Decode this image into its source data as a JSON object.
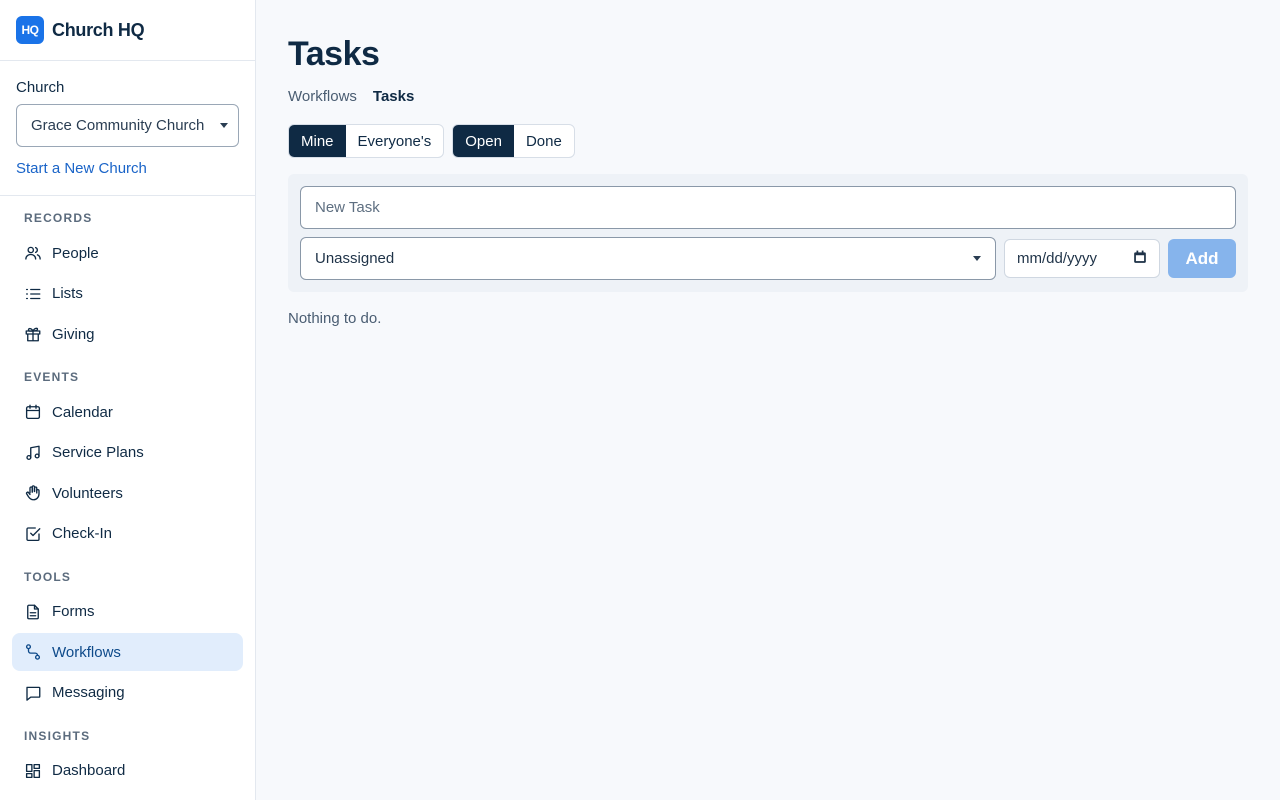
{
  "brand": {
    "logo": "HQ",
    "name": "Church HQ"
  },
  "church": {
    "label": "Church",
    "selected": "Grace Community Church",
    "new_link": "Start a New Church"
  },
  "nav": {
    "records": {
      "title": "RECORDS",
      "items": [
        {
          "label": "People",
          "icon": "people-icon"
        },
        {
          "label": "Lists",
          "icon": "list-icon"
        },
        {
          "label": "Giving",
          "icon": "gift-icon"
        }
      ]
    },
    "events": {
      "title": "EVENTS",
      "items": [
        {
          "label": "Calendar",
          "icon": "calendar-icon"
        },
        {
          "label": "Service Plans",
          "icon": "music-note-icon"
        },
        {
          "label": "Volunteers",
          "icon": "hand-icon"
        },
        {
          "label": "Check-In",
          "icon": "checkbox-icon"
        }
      ]
    },
    "tools": {
      "title": "TOOLS",
      "items": [
        {
          "label": "Forms",
          "icon": "document-icon"
        },
        {
          "label": "Workflows",
          "icon": "workflow-icon",
          "active": true
        },
        {
          "label": "Messaging",
          "icon": "message-icon"
        }
      ]
    },
    "insights": {
      "title": "INSIGHTS",
      "items": [
        {
          "label": "Dashboard",
          "icon": "dashboard-icon"
        }
      ]
    }
  },
  "page": {
    "title": "Tasks",
    "breadcrumb": {
      "parent": "Workflows",
      "current": "Tasks"
    }
  },
  "filters": {
    "owner": {
      "mine": "Mine",
      "everyone": "Everyone's",
      "selected": "Mine"
    },
    "status": {
      "open": "Open",
      "done": "Done",
      "selected": "Open"
    }
  },
  "form": {
    "task_placeholder": "New Task",
    "assignee": "Unassigned",
    "date_placeholder": "mm/dd/yyyy",
    "add_label": "Add"
  },
  "empty_text": "Nothing to do.",
  "colors": {
    "primary": "#0f2a44",
    "accent": "#1a73e8",
    "active_bg": "#e1edfc",
    "add_button": "#86b4ec"
  }
}
